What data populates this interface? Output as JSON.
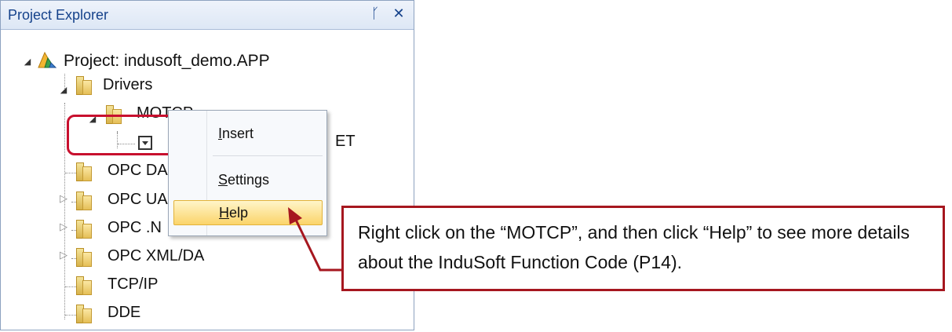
{
  "panel": {
    "title": "Project Explorer",
    "pin_label": "ᚴ",
    "close_label": "✕"
  },
  "tree": {
    "root": "Project: indusoft_demo.APP",
    "drivers": "Drivers",
    "motcp": "MOTCP",
    "motcp_child_suffix": "ET",
    "opc_da": "OPC DA",
    "opc_ua": "OPC UA",
    "opc_net": "OPC .N",
    "opc_xml": "OPC XML/DA",
    "tcpip": "TCP/IP",
    "dde": "DDE"
  },
  "context_menu": {
    "items": [
      {
        "label": "Insert",
        "accel": "I"
      },
      {
        "label": "Settings",
        "accel": "S"
      },
      {
        "label": "Help",
        "accel": "H"
      }
    ]
  },
  "callout": {
    "text": "Right click on the “MOTCP”, and then click “Help” to see more details about the InduSoft Function Code (P14)."
  },
  "colors": {
    "highlight": "#c8102e",
    "callout_border": "#a6171f",
    "menu_hover": "#fbd46a"
  }
}
